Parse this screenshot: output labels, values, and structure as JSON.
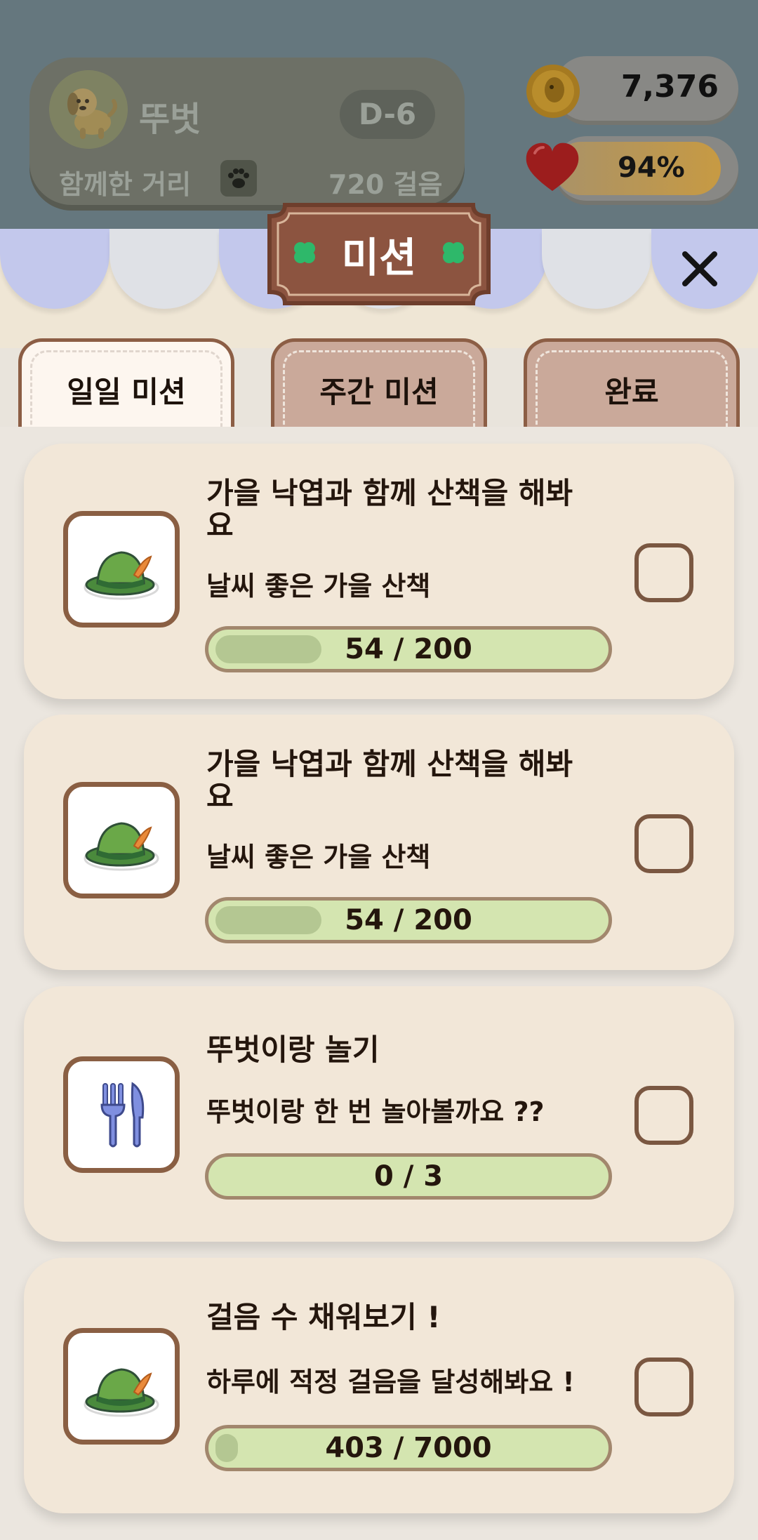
{
  "header": {
    "pet_name": "뚜벗",
    "dday": "D-6",
    "distance_label": "함께한 거리",
    "distance_value": "720 걸음",
    "coins": "7,376",
    "heart_percent": "94%",
    "heart_fill_fraction": 0.94
  },
  "dialog": {
    "title": "미션"
  },
  "tabs": [
    {
      "label": "일일 미션",
      "active": true
    },
    {
      "label": "주간 미션",
      "active": false
    },
    {
      "label": "완료",
      "active": false
    }
  ],
  "missions": [
    {
      "icon": "hat-icon",
      "title": "가을 낙엽과 함께 산책을 해봐요",
      "desc": "날씨 좋은 가을 산책",
      "progress_text": "54 / 200",
      "current": 54,
      "target": 200,
      "checked": false
    },
    {
      "icon": "hat-icon",
      "title": "가을 낙엽과 함께 산책을 해봐요",
      "desc": "날씨 좋은 가을 산책",
      "progress_text": "54 / 200",
      "current": 54,
      "target": 200,
      "checked": false
    },
    {
      "icon": "fork-knife-icon",
      "title": "뚜벗이랑 놀기",
      "desc": "뚜벗이랑 한 번 놀아볼까요 ??",
      "progress_text": "0 / 3",
      "current": 0,
      "target": 3,
      "checked": false
    },
    {
      "icon": "hat-icon",
      "title": "걸음 수 채워보기 !",
      "desc": "하루에 적정 걸음을 달성해봐요 !",
      "progress_text": "403 / 7000",
      "current": 403,
      "target": 7000,
      "checked": false
    }
  ],
  "colors": {
    "accent_brown": "#8a5f43",
    "progress_green": "#d4e5b0",
    "clover_green": "#2eb86a"
  }
}
